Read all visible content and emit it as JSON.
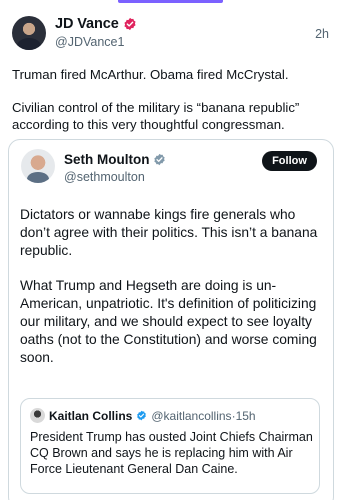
{
  "colors": {
    "accent_bar": "#7b61ff",
    "verified_pink": "#e0245e",
    "verified_gray": "#829aab",
    "verified_blue": "#1d9bf0",
    "text_primary": "#0f1419",
    "text_secondary": "#536471"
  },
  "post": {
    "author": {
      "name": "JD Vance",
      "handle": "@JDVance1",
      "verified_icon": "verified-badge-pink-icon"
    },
    "time": "2h",
    "text_lines": [
      "Truman fired McArthur. Obama fired McCrystal.",
      "Civilian control of the military is “banana republic” according to this very thoughtful congressman."
    ]
  },
  "quoted_post": {
    "author": {
      "name": "Seth Moulton",
      "handle": "@sethmoulton",
      "verified_icon": "verified-badge-gray-icon"
    },
    "follow_label": "Follow",
    "paragraphs": [
      "Dictators or wannabe kings fire generals who don’t agree with their politics. This isn’t a banana republic.",
      "What Trump and Hegseth are doing is un-American, unpatriotic. It's definition of politicizing our military, and we should expect to see loyalty oaths (not to the Constitution) and worse coming soon."
    ],
    "nested": {
      "author": {
        "name": "Kaitlan Collins",
        "handle": "@kaitlancollins",
        "verified_icon": "verified-badge-blue-icon"
      },
      "separator": "·",
      "time": "15h",
      "text": "President Trump has ousted Joint Chiefs Chairman CQ Brown and says he is replacing him with Air Force Lieutenant General Dan Caine."
    }
  }
}
